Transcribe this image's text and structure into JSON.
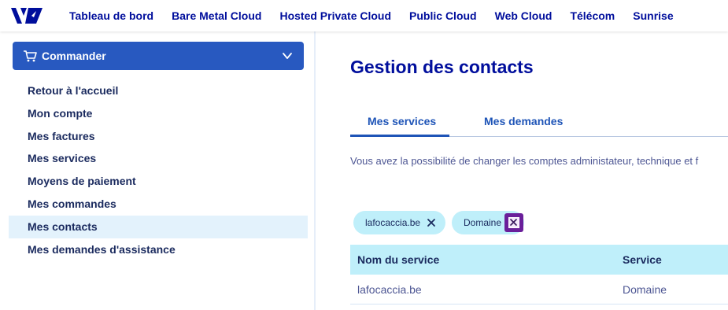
{
  "nav": {
    "logo": "ovh-logo-icon",
    "items": [
      "Tableau de bord",
      "Bare Metal Cloud",
      "Hosted Private Cloud",
      "Public Cloud",
      "Web Cloud",
      "Télécom",
      "Sunrise"
    ]
  },
  "sidebar": {
    "commander_label": "Commander",
    "items": [
      {
        "label": "Retour à l'accueil"
      },
      {
        "label": "Mon compte"
      },
      {
        "label": "Mes factures"
      },
      {
        "label": "Mes services"
      },
      {
        "label": "Moyens de paiement"
      },
      {
        "label": "Mes commandes"
      },
      {
        "label": "Mes contacts",
        "active": true
      },
      {
        "label": "Mes demandes d'assistance"
      }
    ]
  },
  "main": {
    "title": "Gestion des contacts",
    "tabs": [
      {
        "label": "Mes services",
        "active": true
      },
      {
        "label": "Mes demandes"
      }
    ],
    "description": "Vous avez la possibilité de changer les comptes administateur, technique et f",
    "filters": [
      "lafocaccia.be",
      "Domaine"
    ],
    "table": {
      "headers": [
        "Nom du service",
        "Service"
      ],
      "rows": [
        [
          "lafocaccia.be",
          "Domaine"
        ]
      ]
    }
  },
  "colors": {
    "brand": "#000e9c",
    "commander_bg": "#2859c0",
    "chip_bg": "#bfeffa",
    "focus": "#6a1f9a",
    "active_item_bg": "#e3f2fc"
  }
}
